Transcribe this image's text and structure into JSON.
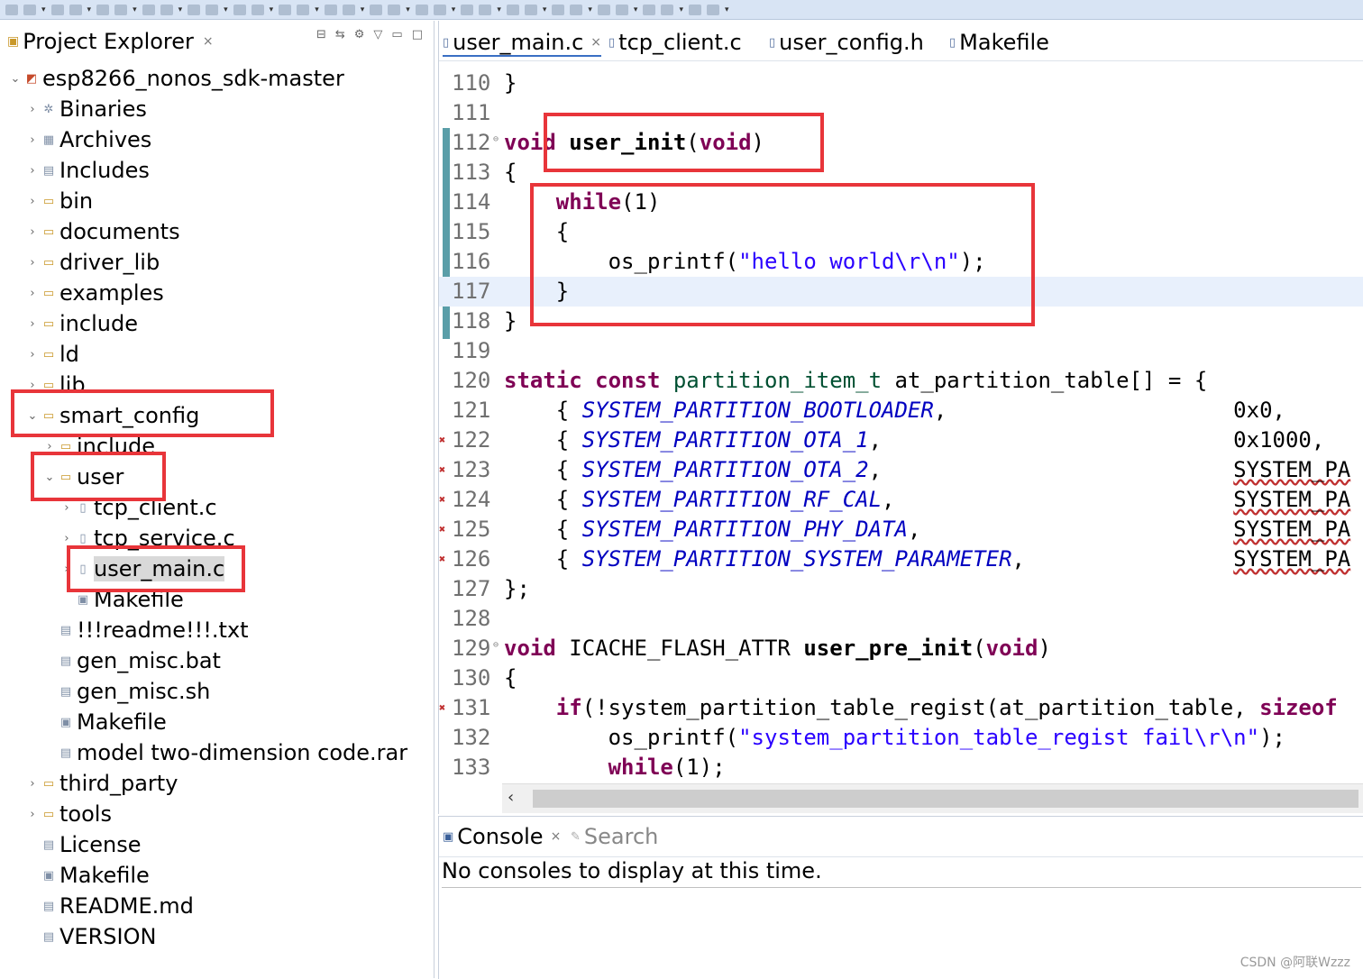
{
  "toolbar": {
    "buttons": [
      "tb1",
      "tb2",
      "tb3",
      "tb4",
      "tb5",
      "tb6",
      "tb7",
      "tb8",
      "tb9",
      "tb10",
      "tb11",
      "tb12",
      "tb13",
      "tb14",
      "tb15",
      "tb16",
      "tb17",
      "tb18",
      "tb19",
      "tb20",
      "tb21",
      "tb22",
      "tb23",
      "tb24",
      "tb25",
      "tb26",
      "tb27",
      "tb28",
      "tb29",
      "tb30",
      "tb31",
      "tb32"
    ]
  },
  "project_explorer": {
    "title": "Project Explorer",
    "close_icon": "×",
    "tree": [
      {
        "label": "esp8266_nonos_sdk-master",
        "depth": 0,
        "chev": "⌄",
        "icon": "project-icon"
      },
      {
        "label": "Binaries",
        "depth": 1,
        "chev": "›",
        "icon": "binaries-icon"
      },
      {
        "label": "Archives",
        "depth": 1,
        "chev": "›",
        "icon": "archives-icon"
      },
      {
        "label": "Includes",
        "depth": 1,
        "chev": "›",
        "icon": "includes-icon"
      },
      {
        "label": "bin",
        "depth": 1,
        "chev": "›",
        "icon": "folder-icon"
      },
      {
        "label": "documents",
        "depth": 1,
        "chev": "›",
        "icon": "folder-icon"
      },
      {
        "label": "driver_lib",
        "depth": 1,
        "chev": "›",
        "icon": "folder-icon"
      },
      {
        "label": "examples",
        "depth": 1,
        "chev": "›",
        "icon": "folder-icon"
      },
      {
        "label": "include",
        "depth": 1,
        "chev": "›",
        "icon": "folder-icon"
      },
      {
        "label": "ld",
        "depth": 1,
        "chev": "›",
        "icon": "folder-icon"
      },
      {
        "label": "lib",
        "depth": 1,
        "chev": "›",
        "icon": "folder-icon"
      },
      {
        "label": "smart_config",
        "depth": 1,
        "chev": "⌄",
        "icon": "folder-icon"
      },
      {
        "label": "include",
        "depth": 2,
        "chev": "›",
        "icon": "folder-icon"
      },
      {
        "label": "user",
        "depth": 2,
        "chev": "⌄",
        "icon": "folder-icon"
      },
      {
        "label": "tcp_client.c",
        "depth": 3,
        "chev": "›",
        "icon": "c-file-icon"
      },
      {
        "label": "tcp_service.c",
        "depth": 3,
        "chev": "›",
        "icon": "c-file-icon"
      },
      {
        "label": "user_main.c",
        "depth": 3,
        "chev": "›",
        "icon": "c-file-icon"
      },
      {
        "label": "Makefile",
        "depth": 3,
        "chev": "",
        "icon": "makefile-icon"
      },
      {
        "label": "!!!readme!!!.txt",
        "depth": 2,
        "chev": "",
        "icon": "text-file-icon"
      },
      {
        "label": "gen_misc.bat",
        "depth": 2,
        "chev": "",
        "icon": "text-file-icon"
      },
      {
        "label": "gen_misc.sh",
        "depth": 2,
        "chev": "",
        "icon": "text-file-icon"
      },
      {
        "label": "Makefile",
        "depth": 2,
        "chev": "",
        "icon": "makefile-icon"
      },
      {
        "label": "model two-dimension code.rar",
        "depth": 2,
        "chev": "",
        "icon": "text-file-icon"
      },
      {
        "label": "third_party",
        "depth": 1,
        "chev": "›",
        "icon": "folder-icon"
      },
      {
        "label": "tools",
        "depth": 1,
        "chev": "›",
        "icon": "folder-icon"
      },
      {
        "label": "License",
        "depth": 1,
        "chev": "",
        "icon": "text-file-icon"
      },
      {
        "label": "Makefile",
        "depth": 1,
        "chev": "",
        "icon": "makefile-icon"
      },
      {
        "label": "README.md",
        "depth": 1,
        "chev": "",
        "icon": "text-file-icon"
      },
      {
        "label": "VERSION",
        "depth": 1,
        "chev": "",
        "icon": "text-file-icon"
      }
    ]
  },
  "editor": {
    "tabs": [
      {
        "label": "user_main.c",
        "active": true,
        "close": "×"
      },
      {
        "label": "tcp_client.c",
        "active": false
      },
      {
        "label": "user_config.h",
        "active": false
      },
      {
        "label": "Makefile",
        "active": false
      }
    ],
    "lines": [
      {
        "n": "110",
        "tokens": [
          [
            "",
            "}"
          ]
        ]
      },
      {
        "n": "111",
        "tokens": []
      },
      {
        "n": "112",
        "fold": "⊖",
        "tokens": [
          [
            "kw",
            "void"
          ],
          [
            "",
            " "
          ],
          [
            "fnb",
            "user_init"
          ],
          [
            "",
            "("
          ],
          [
            "kw",
            "void"
          ],
          [
            "",
            ")"
          ]
        ]
      },
      {
        "n": "113",
        "tokens": [
          [
            "",
            "{"
          ]
        ]
      },
      {
        "n": "114",
        "tokens": [
          [
            "",
            "    "
          ],
          [
            "kw",
            "while"
          ],
          [
            "",
            "(1)"
          ]
        ]
      },
      {
        "n": "115",
        "tokens": [
          [
            "",
            "    {"
          ]
        ]
      },
      {
        "n": "116",
        "tokens": [
          [
            "",
            "        os_printf("
          ],
          [
            "str",
            "\"hello world\\r\\n\""
          ],
          [
            "",
            ");"
          ]
        ]
      },
      {
        "n": "117",
        "current": true,
        "tokens": [
          [
            "",
            "    }"
          ]
        ]
      },
      {
        "n": "118",
        "tokens": [
          [
            "",
            "}"
          ]
        ]
      },
      {
        "n": "119",
        "tokens": []
      },
      {
        "n": "120",
        "tokens": [
          [
            "kw",
            "static"
          ],
          [
            "",
            " "
          ],
          [
            "kw",
            "const"
          ],
          [
            "",
            " "
          ],
          [
            "type",
            "partition_item_t"
          ],
          [
            "",
            " at_partition_table[] = {"
          ]
        ]
      },
      {
        "n": "121",
        "tokens": [
          [
            "",
            "    { "
          ],
          [
            "const",
            "SYSTEM_PARTITION_BOOTLOADER"
          ],
          [
            "",
            ",                      0x0,"
          ]
        ]
      },
      {
        "n": "122",
        "marker": "✖",
        "tokens": [
          [
            "",
            "    { "
          ],
          [
            "const",
            "SYSTEM_PARTITION_OTA_1"
          ],
          [
            "",
            ",                           0x1000,"
          ]
        ]
      },
      {
        "n": "123",
        "marker": "✖",
        "tokens": [
          [
            "",
            "    { "
          ],
          [
            "const",
            "SYSTEM_PARTITION_OTA_2"
          ],
          [
            "",
            ",                           "
          ],
          [
            "sq",
            "SYSTEM_PA"
          ]
        ]
      },
      {
        "n": "124",
        "marker": "✖",
        "tokens": [
          [
            "",
            "    { "
          ],
          [
            "const",
            "SYSTEM_PARTITION_RF_CAL"
          ],
          [
            "",
            ",                          "
          ],
          [
            "sq",
            "SYSTEM_PA"
          ]
        ]
      },
      {
        "n": "125",
        "marker": "✖",
        "tokens": [
          [
            "",
            "    { "
          ],
          [
            "const",
            "SYSTEM_PARTITION_PHY_DATA"
          ],
          [
            "",
            ",                        "
          ],
          [
            "sq",
            "SYSTEM_PA"
          ]
        ]
      },
      {
        "n": "126",
        "marker": "✖",
        "tokens": [
          [
            "",
            "    { "
          ],
          [
            "const",
            "SYSTEM_PARTITION_SYSTEM_PARAMETER"
          ],
          [
            "",
            ",                "
          ],
          [
            "sq",
            "SYSTEM_PA"
          ]
        ]
      },
      {
        "n": "127",
        "tokens": [
          [
            "",
            "};"
          ]
        ]
      },
      {
        "n": "128",
        "tokens": []
      },
      {
        "n": "129",
        "fold": "⊖",
        "tokens": [
          [
            "kw",
            "void"
          ],
          [
            "",
            " ICACHE_FLASH_ATTR "
          ],
          [
            "fnb",
            "user_pre_init"
          ],
          [
            "",
            "("
          ],
          [
            "kw",
            "void"
          ],
          [
            "",
            ")"
          ]
        ]
      },
      {
        "n": "130",
        "tokens": [
          [
            "",
            "{"
          ]
        ]
      },
      {
        "n": "131",
        "marker": "✖",
        "tokens": [
          [
            "",
            "    "
          ],
          [
            "kw",
            "if"
          ],
          [
            "",
            "(!system_partition_table_regist(at_partition_table, "
          ],
          [
            "kw",
            "sizeof"
          ]
        ]
      },
      {
        "n": "132",
        "tokens": [
          [
            "",
            "        os_printf("
          ],
          [
            "str",
            "\"system_partition_table_regist fail\\r\\n\""
          ],
          [
            "",
            ");"
          ]
        ]
      },
      {
        "n": "133",
        "tokens": [
          [
            "",
            "        "
          ],
          [
            "kw",
            "while"
          ],
          [
            "",
            "(1);"
          ]
        ]
      }
    ],
    "scroll_left": "‹"
  },
  "console": {
    "tabs": [
      {
        "label": "Console",
        "active": true,
        "close": "×"
      },
      {
        "label": "Search",
        "active": false
      }
    ],
    "message": "No consoles to display at this time."
  },
  "watermark": "CSDN @阿联Wzzz",
  "colors": {
    "annotation": "#e8353a",
    "keyword": "#7f0055",
    "string": "#2a00ff",
    "constant": "#0000c0"
  }
}
